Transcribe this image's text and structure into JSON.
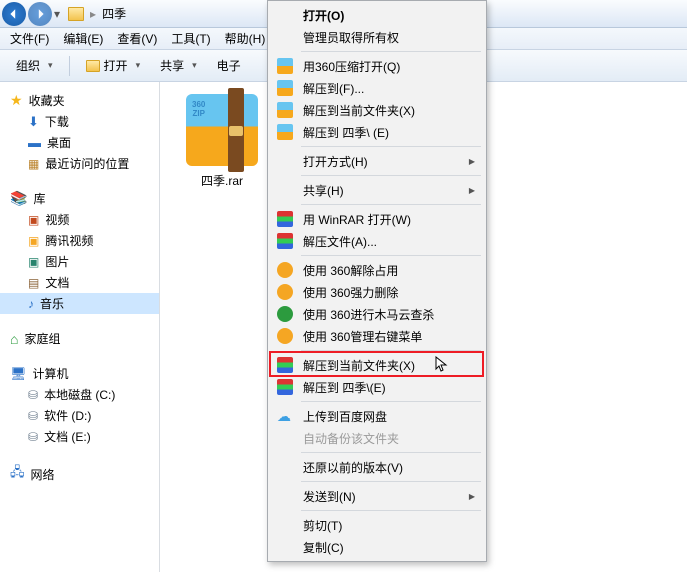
{
  "nav": {
    "location": "四季"
  },
  "menu": [
    "文件(F)",
    "编辑(E)",
    "查看(V)",
    "工具(T)",
    "帮助(H)"
  ],
  "toolbar": {
    "organize": "组织",
    "open": "打开",
    "share": "共享",
    "email": "电子"
  },
  "sidebar": {
    "favorites": {
      "label": "收藏夹",
      "items": [
        "下载",
        "桌面",
        "最近访问的位置"
      ]
    },
    "libraries": {
      "label": "库",
      "items": [
        "视频",
        "腾讯视频",
        "图片",
        "文档",
        "音乐"
      ],
      "selected": 4
    },
    "homegroup": {
      "label": "家庭组"
    },
    "computer": {
      "label": "计算机",
      "items": [
        "本地磁盘 (C:)",
        "软件 (D:)",
        "文档 (E:)"
      ]
    },
    "network": {
      "label": "网络"
    }
  },
  "file": {
    "name": "四季.rar"
  },
  "ctx": {
    "items": [
      {
        "label": "打开(O)",
        "bold": true
      },
      {
        "label": "管理员取得所有权"
      },
      {
        "sep": true
      },
      {
        "label": "用360压缩打开(Q)",
        "icon": "zip"
      },
      {
        "label": "解压到(F)...",
        "icon": "zip"
      },
      {
        "label": "解压到当前文件夹(X)",
        "icon": "zip"
      },
      {
        "label": "解压到 四季\\ (E)",
        "icon": "zip"
      },
      {
        "sep": true
      },
      {
        "label": "打开方式(H)",
        "sub": true
      },
      {
        "sep": true
      },
      {
        "label": "共享(H)",
        "sub": true
      },
      {
        "sep": true
      },
      {
        "label": "用 WinRAR 打开(W)",
        "icon": "rar"
      },
      {
        "label": "解压文件(A)...",
        "icon": "rar"
      },
      {
        "sep": true
      },
      {
        "label": "使用 360解除占用",
        "icon": "360"
      },
      {
        "label": "使用 360强力删除",
        "icon": "360"
      },
      {
        "label": "使用 360进行木马云查杀",
        "icon": "360g"
      },
      {
        "label": "使用 360管理右键菜单",
        "icon": "360"
      },
      {
        "sep": true
      },
      {
        "label": "解压到当前文件夹(X)",
        "icon": "rar",
        "hl": true
      },
      {
        "label": "解压到 四季\\(E)",
        "icon": "rar"
      },
      {
        "sep": true
      },
      {
        "label": "上传到百度网盘",
        "icon": "cloud"
      },
      {
        "label": "自动备份该文件夹",
        "disabled": true
      },
      {
        "sep": true
      },
      {
        "label": "还原以前的版本(V)"
      },
      {
        "sep": true
      },
      {
        "label": "发送到(N)",
        "sub": true
      },
      {
        "sep": true
      },
      {
        "label": "剪切(T)"
      },
      {
        "label": "复制(C)"
      }
    ]
  }
}
